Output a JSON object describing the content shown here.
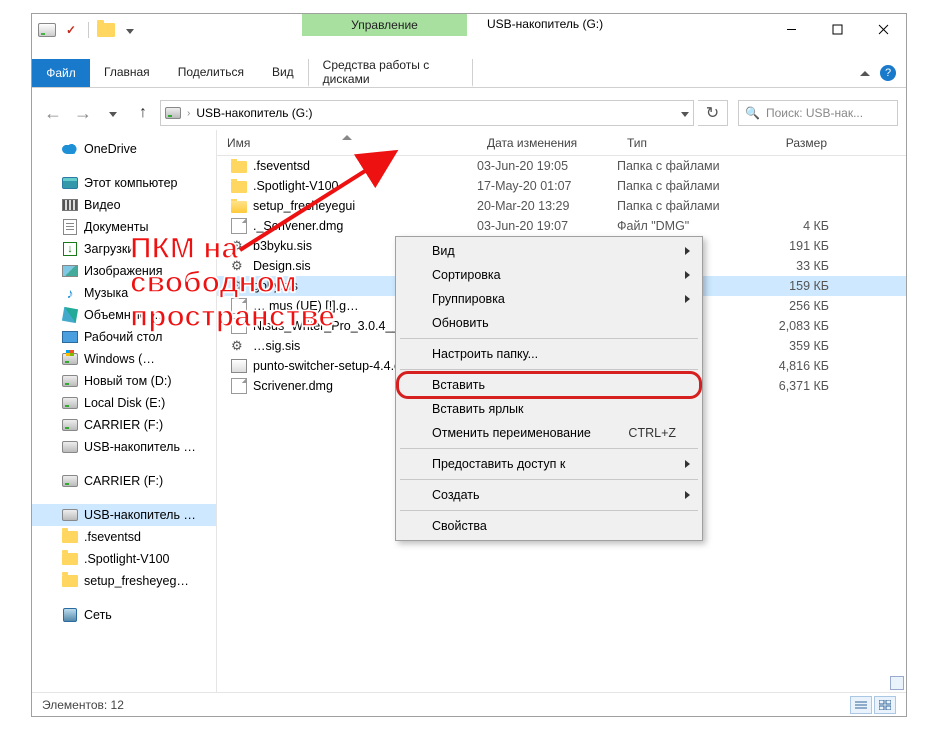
{
  "window": {
    "contextual_label": "Управление",
    "title": "USB-накопитель (G:)"
  },
  "ribbon": {
    "file": "Файл",
    "tabs": [
      "Главная",
      "Поделиться",
      "Вид"
    ],
    "contextual_tab": "Средства работы с дисками"
  },
  "address": {
    "crumb": "USB-накопитель (G:)"
  },
  "search": {
    "placeholder": "Поиск: USB-нак..."
  },
  "columns": {
    "name": "Имя",
    "date": "Дата изменения",
    "type": "Тип",
    "size": "Размер"
  },
  "tree": {
    "onedrive": "OneDrive",
    "this_pc": "Этот компьютер",
    "videos": "Видео",
    "documents": "Документы",
    "downloads": "Загрузки",
    "pictures": "Изображения",
    "music": "Музыка",
    "objects3d": "Объемные …",
    "desktop": "Рабочий стол",
    "drv_c": "Windows (…",
    "drv_d": "Новый том (D:)",
    "drv_e": "Local Disk (E:)",
    "drv_f": "CARRIER (F:)",
    "drv_g": "USB-накопитель …",
    "carrier": "CARRIER (F:)",
    "usb": "USB-накопитель …",
    "sub1": ".fseventsd",
    "sub2": ".Spotlight-V100",
    "sub3": "setup_fresheyeg…",
    "network": "Сеть"
  },
  "files": [
    {
      "icon": "folder",
      "name": ".fseventsd",
      "date": "03-Jun-20 19:05",
      "type": "Папка с файлами",
      "size": ""
    },
    {
      "icon": "folder",
      "name": ".Spotlight-V100",
      "date": "17-May-20 01:07",
      "type": "Папка с файлами",
      "size": ""
    },
    {
      "icon": "folder-open",
      "name": "setup_fresheyegui",
      "date": "20-Mar-20 13:29",
      "type": "Папка с файлами",
      "size": ""
    },
    {
      "icon": "file",
      "name": "._Scrivener.dmg",
      "date": "03-Jun-20 19:07",
      "type": "Файл \"DMG\"",
      "size": "4 КБ"
    },
    {
      "icon": "cog",
      "name": "b3byku.sis",
      "date": "",
      "type": "",
      "size": "191 КБ"
    },
    {
      "icon": "cog",
      "name": "Design.sis",
      "date": "",
      "type": "",
      "size": "33 КБ"
    },
    {
      "icon": "cog",
      "name": "goby.sis",
      "date": "",
      "type": "",
      "size": "159 КБ",
      "sel": true
    },
    {
      "icon": "file",
      "name": "… mus (UE) [!].g…",
      "date": "",
      "type": "",
      "size": "256 КБ"
    },
    {
      "icon": "file",
      "name": "Nisus_Writer_Pro_3.0.4__TNT_Torrentm…",
      "date": "",
      "type": "",
      "size": "2,083 КБ"
    },
    {
      "icon": "cog",
      "name": "…sig.sis",
      "date": "",
      "type": "",
      "size": "359 КБ"
    },
    {
      "icon": "exe",
      "name": "punto-switcher-setup-4.4.exe",
      "date": "",
      "type": "",
      "size": "4,816 КБ"
    },
    {
      "icon": "file",
      "name": "Scrivener.dmg",
      "date": "",
      "type": "",
      "size": "6,371 КБ"
    }
  ],
  "context_menu": {
    "view": "Вид",
    "sort": "Сортировка",
    "group": "Группировка",
    "refresh": "Обновить",
    "customize": "Настроить папку...",
    "paste": "Вставить",
    "paste_shortcut": "Вставить ярлык",
    "undo_rename": "Отменить переименование",
    "undo_key": "CTRL+Z",
    "give_access": "Предоставить доступ к",
    "new": "Создать",
    "properties": "Свойства"
  },
  "status": {
    "count": "Элементов: 12"
  },
  "annotation": {
    "line1": "ПКМ на",
    "line2": "свободном",
    "line3": "пространстве"
  }
}
